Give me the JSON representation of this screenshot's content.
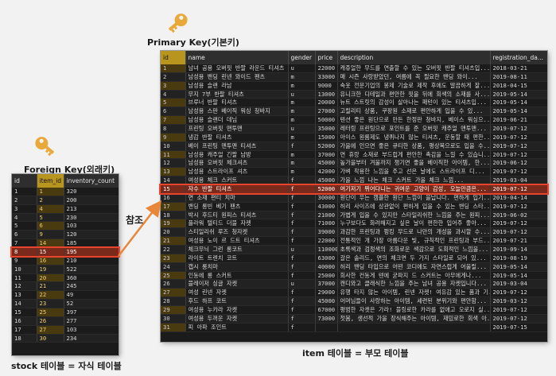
{
  "labels": {
    "primary_key": "Primary Key(기본키)",
    "foreign_key": "Foreign Key(외래키)",
    "reference": "참조",
    "item_caption": "item 테이블 = 부모 테이블",
    "stock_caption": "stock 테이블 = 자식 테이블"
  },
  "item_table": {
    "columns": [
      "id",
      "name",
      "gender",
      "price",
      "description",
      "registration_da..."
    ],
    "highlight_col": 0,
    "rows": [
      [
        "1",
        "남녀 공용 오버핏 반팔 라운드 티셔츠",
        "u",
        "22000",
        "캐쥬얼한 무드를 연출할 수 있는 오버핏 반팔 티셔츠입...",
        "2018-03-21"
      ],
      [
        "2",
        "남성용 밴딩 린넨 와이드 팬츠",
        "m",
        "33000",
        "매 시즌 사랑받았던, 여름에 꼭 필요한 밴딩 와이...",
        "2019-08-11"
      ],
      [
        "3",
        "남성용 슬랜 라남",
        "m",
        "9000",
        "속옷 전문기업의 봉제 기술로 제작 후에도 말끔하게 잘...",
        "2018-04-15"
      ],
      [
        "4",
        "무지 7부 반팔 티셔츠",
        "u",
        "13000",
        "유니크한 디테일과 편안한 핏을 뒤에 회색의 소재를 사...",
        "2019-05-14"
      ],
      [
        "5",
        "브루너 반팔 티셔츠",
        "m",
        "20000",
        "뉴트 스트릿의 감성이 살아나는 패턴이 있는 티셔츠입...",
        "2019-05-14"
      ],
      [
        "6",
        "남성용 스판 베이직 워싱 청바지",
        "m",
        "27000",
        "고릴리티 상품, 쿠팡원 소재로 편안하게 입을 수 있...",
        "2019-05-14"
      ],
      [
        "7",
        "남성용 슬랜더 데님",
        "m",
        "50000",
        "텐션 좋은 원단으로 만든 한정판 청바지, 베이스 워싱으...",
        "2019-06-21"
      ],
      [
        "8",
        "프린팅 오버핏 맨투맨",
        "u",
        "35000",
        "레터링 프린팅으로 포인트를 준 오버핏 캐주얼 맨투맨...",
        "2019-07-12"
      ],
      [
        "9",
        "냉감 반팔 티셔츠",
        "m",
        "15000",
        "아이스 원룸제도 냉퀴나지 않는 티셔츠, 운동할 때 편한...",
        "2019-07-12"
      ],
      [
        "10",
        "베이 프린팅 맨투맨 티셔츠",
        "f",
        "52000",
        "가을에 인으면 좋은 큐티한 상품, 평상복으로도 입을 수...",
        "2019-07-12"
      ],
      [
        "11",
        "남성용 캐주얼 긴팔 남방",
        "m",
        "37000",
        "연 휴랑 소재로 부드럽게 편안한 촉감을 느낄 수 있습니...",
        "2019-07-12"
      ],
      [
        "12",
        "남성용 오버핏 체크셔츠",
        "m",
        "45000",
        "높가을부터 겨울까지 챙기면 좋을 베이직한 아이템, 한...",
        "2019-06-12"
      ],
      [
        "13",
        "남성용 스트라이프 셔츠",
        "m",
        "42000",
        "가벼 착용한 느낌을 주고 선은 날에도 스트라이프 디...",
        "2019-07-12"
      ],
      [
        "14",
        "여성용 체크 스커트",
        "f",
        "45000",
        "가을 느낌 나는 체크 스커트 가을 체크 느낌...",
        "2019-03-04"
      ],
      [
        "15",
        "자수 반팔 티셔츠",
        "f",
        "52000",
        "여기저기 뛰어다니는 귀여운 고양이 감성, 오늘만큼은...",
        "2019-07-12"
      ],
      [
        "16",
        "면 소재 편티 치마",
        "f",
        "30000",
        "원단이 우는 캠플한 원단 느낌이 을납니다. 편하게 입기...",
        "2019-04-14"
      ],
      [
        "17",
        "밴딩 롱빈 베기 팬츠",
        "f",
        "43000",
        "허리 사이즈에 상관없이 편하게 입을 수 있는 밴딩 스타...",
        "2019-07-12"
      ],
      [
        "18",
        "박시 후드티 원피스 티셔츠",
        "f",
        "21000",
        "가볍게 입을 수 있지만 스타일리쉬한 느낌을 주는 원피...",
        "2019-06-02"
      ],
      [
        "19",
        "플라워 텔티드 더블 자켓",
        "f",
        "71000",
        "누구보다도 화려해지고 싶은 날이 편한한 입어주 좋아...",
        "2019-07-12"
      ],
      [
        "20",
        "스티일리쉬 루즈 청자켓",
        "f",
        "39000",
        "과감한 프린팅과 펑킹 무드로 나만의 개성을 과시할 수...",
        "2019-07-12"
      ],
      [
        "21",
        "여성용 노이 르 드트 티셔츠",
        "f",
        "22000",
        "전통적인 개 가장 아름다운 빛, 규칙적인 프린팅과 부드...",
        "2019-07-21"
      ],
      [
        "22",
        "체크무늬 그런 롱코트",
        "u",
        "110000",
        "초록색과 검정색의 조화로운 색감으로 도회적인 느낌을...",
        "2019-09-14"
      ],
      [
        "23",
        "라이트 트렌치 코트",
        "f",
        "63000",
        "갈은 솔리드, 면의 체크면 두 가지 스타일로 되어 있...",
        "2019-08-19"
      ],
      [
        "24",
        "캡시 롱치마",
        "f",
        "40000",
        "허리 밴딩 타입으로 어떤 코디에도 자연스럽게 어울릴...",
        "2019-05-14"
      ],
      [
        "25",
        "인동에 롱 스커트",
        "f",
        "25000",
        "회사한 컨동게 텐에 굳파지 드 스커트는 아무에게나...",
        "2019-05-14"
      ],
      [
        "26",
        "블레이저 싱글 자켓",
        "u",
        "37000",
        "캔디와고 클래식한 느낌을 주는 남녀 공용 자켓입니다...",
        "2019-03-04"
      ],
      [
        "27",
        "여성 린넨 자켓",
        "f",
        "29000",
        "유행 타지 않는 아이템, 린넨 자켓! 여유감 있는 품과 기...",
        "2019-07-12"
      ],
      [
        "28",
        "후드 하프 코트",
        "f",
        "45000",
        "어머님들이 사랑하는 아이템, 세련된 분위기와 편안함...",
        "2019-03-12"
      ],
      [
        "29",
        "여성용 누카라 자켓",
        "f",
        "67000",
        "평범한 자켓은 가라! 블링로한 카라를 없애고 오로지 실...",
        "2019-07-12"
      ],
      [
        "30",
        "여성용 두꺼운 자켓",
        "f",
        "73000",
        "첫봄, 생선적 가을 장식해주는 아이템, 재밌로한 회색 아...",
        "2019-07-12"
      ],
      [
        "31",
        "피 아파 조인트",
        "f",
        "",
        "",
        "2019-07-15"
      ]
    ]
  },
  "stock_table": {
    "columns": [
      "id",
      "item_id",
      "inventory_count"
    ],
    "highlight_col": 1,
    "rows": [
      [
        "1",
        "1",
        "320"
      ],
      [
        "2",
        "2",
        "200"
      ],
      [
        "3",
        "4",
        "213"
      ],
      [
        "4",
        "5",
        "230"
      ],
      [
        "5",
        "6",
        "103"
      ],
      [
        "6",
        "9",
        "120"
      ],
      [
        "7",
        "14",
        "185"
      ],
      [
        "8",
        "15",
        "195"
      ],
      [
        "9",
        "16",
        "210"
      ],
      [
        "10",
        "19",
        "522"
      ],
      [
        "11",
        "20",
        "360"
      ],
      [
        "12",
        "21",
        "245"
      ],
      [
        "13",
        "22",
        "49"
      ],
      [
        "14",
        "23",
        "52"
      ],
      [
        "15",
        "25",
        "397"
      ],
      [
        "16",
        "26",
        "277"
      ],
      [
        "17",
        "27",
        "103"
      ],
      [
        "18",
        "30",
        "234"
      ]
    ]
  },
  "selection": {
    "item_row_id": "15",
    "stock_row_id": "8"
  },
  "colors": {
    "highlight_outline": "#e8452f",
    "arrow": "#e8863a",
    "key_gold": "#e9a93a",
    "column_highlight": "#b8951f"
  },
  "icons": {
    "primary_key": "key-icon",
    "foreign_key": "key-icon"
  }
}
